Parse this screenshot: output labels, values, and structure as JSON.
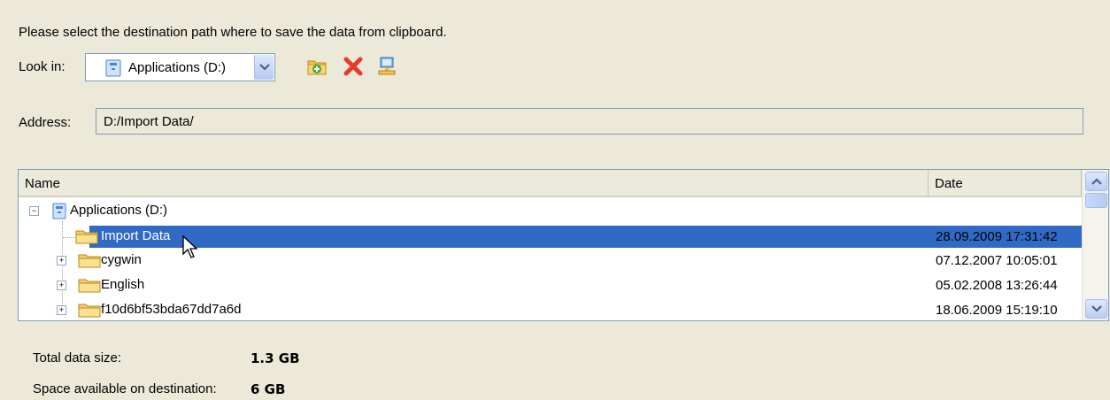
{
  "instruction": "Please select the destination path where to save the data from clipboard.",
  "look_in": {
    "label": "Look in:",
    "value": "Applications (D:)"
  },
  "toolbar": {
    "icons": [
      "new-folder-icon",
      "delete-icon",
      "network-icon"
    ]
  },
  "address": {
    "label": "Address:",
    "value": "D:/Import Data/"
  },
  "file_list": {
    "columns": [
      "Name",
      "Date"
    ],
    "root": {
      "name": "Applications (D:)",
      "icon": "drive-icon"
    },
    "rows": [
      {
        "name": "Import Data",
        "date": "28.09.2009 17:31:42",
        "selected": true,
        "expandable": false
      },
      {
        "name": "cygwin",
        "date": "07.12.2007 10:05:01",
        "selected": false,
        "expandable": true
      },
      {
        "name": "English",
        "date": "05.02.2008 13:26:44",
        "selected": false,
        "expandable": true
      },
      {
        "name": "f10d6bf53bda67dd7a6d",
        "date": "18.06.2009 15:19:10",
        "selected": false,
        "expandable": true
      }
    ]
  },
  "summary": {
    "total_label": "Total data size:",
    "total_value": "1.3 GB",
    "space_label": "Space available on destination:",
    "space_value": "6 GB"
  },
  "colors": {
    "background": "#ece9d8",
    "selection": "#316ac5",
    "border": "#7f9db9"
  }
}
